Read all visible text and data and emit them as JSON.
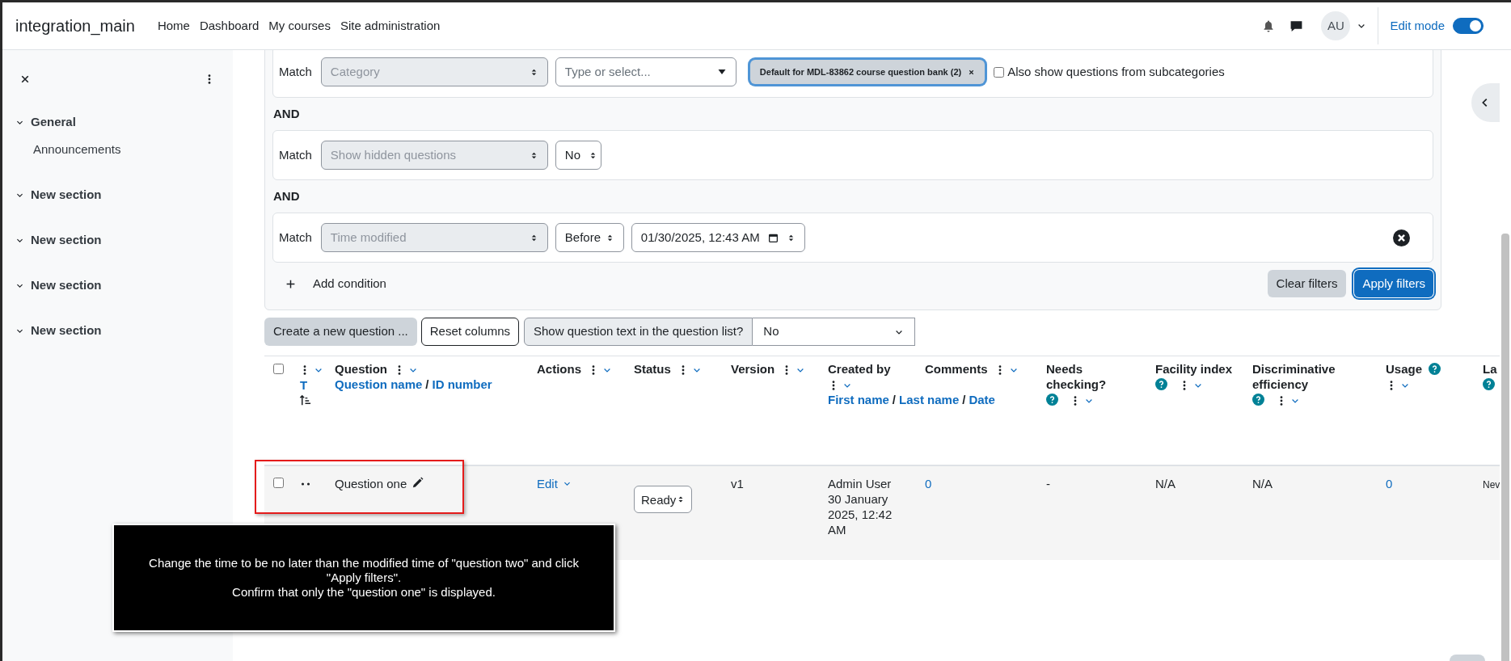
{
  "top_nav": {
    "site_name": "integration_main",
    "links": [
      "Home",
      "Dashboard",
      "My courses",
      "Site administration"
    ],
    "user_initials": "AU",
    "edit_mode": {
      "label": "Edit mode",
      "on": true
    }
  },
  "sidebar": {
    "items": [
      {
        "label": "General",
        "children": [
          {
            "label": "Announcements"
          }
        ]
      },
      {
        "label": "New section"
      },
      {
        "label": "New section"
      },
      {
        "label": "New section"
      },
      {
        "label": "New section"
      }
    ]
  },
  "filters": {
    "conditions": [
      {
        "kind": "category",
        "match_label": "Match",
        "field": "Category",
        "placeholder": "Type or select...",
        "tag": "Default for MDL-83862 course question bank (2)",
        "checkbox_label": "Also show questions from subcategories",
        "checked": false
      },
      {
        "kind": "select",
        "joiner": "AND",
        "match_label": "Match",
        "field": "Show hidden questions",
        "value": "No"
      },
      {
        "kind": "datetime",
        "joiner": "AND",
        "match_label": "Match",
        "field": "Time modified",
        "operator": "Before",
        "value": "01/30/2025, 12:43 AM",
        "removable": true
      }
    ],
    "add_condition": "Add condition",
    "clear_button": "Clear filters",
    "apply_button": "Apply filters"
  },
  "toolbar": {
    "create_button": "Create a new question ...",
    "reset_button": "Reset columns",
    "show_text_label": "Show question text in the question list?",
    "show_text_value": "No"
  },
  "table": {
    "columns": [
      {
        "kind": "checkbox",
        "checked": false
      },
      {
        "kind": "type",
        "menu": true,
        "sort": [
          {
            "kind": "link",
            "label": "T"
          }
        ],
        "sort_icon": true
      },
      {
        "title": "Question",
        "menu": true,
        "sort": [
          {
            "kind": "link",
            "label": "Question name"
          },
          {
            "kind": "sep",
            "label": "/"
          },
          {
            "kind": "link",
            "label": "ID number"
          }
        ]
      },
      {
        "title": "Actions",
        "menu": true
      },
      {
        "title": "Status",
        "menu": true
      },
      {
        "title": "Version",
        "menu": true
      },
      {
        "title": "Created by",
        "menu": true,
        "sort": [
          {
            "kind": "link",
            "label": "First name"
          },
          {
            "kind": "sep",
            "label": "/"
          },
          {
            "kind": "link",
            "label": "Last name"
          },
          {
            "kind": "sep",
            "label": "/"
          },
          {
            "kind": "link",
            "label": "Date"
          }
        ]
      },
      {
        "title": "Comments",
        "menu": true
      },
      {
        "title": "Needs checking?",
        "help": true,
        "menu": true
      },
      {
        "title": "Facility index",
        "help": true,
        "menu": true
      },
      {
        "title": "Discriminative efficiency",
        "help": true,
        "menu": true
      },
      {
        "title": "Usage",
        "help": true,
        "menu": true
      },
      {
        "title": "La",
        "help": true
      }
    ],
    "rows": [
      {
        "checked": false,
        "name": "Question one",
        "action": "Edit",
        "status": "Ready",
        "version": "v1",
        "created_by": "Admin User 30 January 2025, 12:42 AM",
        "comments": "0",
        "needs_checking": "-",
        "facility_index": "N/A",
        "discriminative_efficiency": "N/A",
        "usage": "0",
        "last_used": "Nev"
      }
    ]
  },
  "instruction": "Change the time to be no later than the modified time of \"question two\" and click \"Apply filters\".\nConfirm that only the \"question one\" is displayed."
}
